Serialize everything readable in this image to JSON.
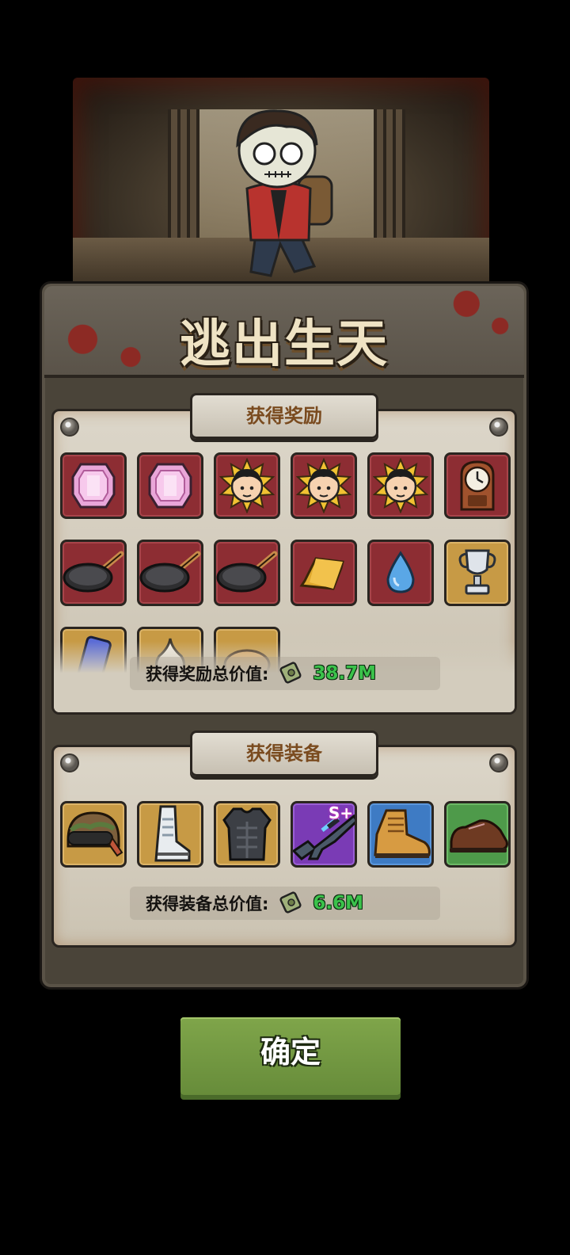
{
  "title": "逃出生天",
  "rewards": {
    "header": "获得奖励",
    "total_label": "获得奖励总价值:",
    "total_value": "38.7M",
    "items": [
      {
        "name": "pink-gem-icon",
        "bg": "red"
      },
      {
        "name": "pink-gem-icon",
        "bg": "red"
      },
      {
        "name": "sun-face-icon",
        "bg": "red"
      },
      {
        "name": "sun-face-icon",
        "bg": "red"
      },
      {
        "name": "sun-face-icon",
        "bg": "red"
      },
      {
        "name": "grandfather-clock-icon",
        "bg": "red"
      },
      {
        "name": "frying-pan-icon",
        "bg": "red"
      },
      {
        "name": "frying-pan-icon",
        "bg": "red"
      },
      {
        "name": "frying-pan-icon",
        "bg": "red"
      },
      {
        "name": "gold-bar-icon",
        "bg": "red"
      },
      {
        "name": "water-drop-icon",
        "bg": "red"
      },
      {
        "name": "silver-trophy-icon",
        "bg": "gold"
      },
      {
        "name": "phone-icon",
        "bg": "gold"
      },
      {
        "name": "garlic-icon",
        "bg": "gold"
      },
      {
        "name": "bread-icon",
        "bg": "gold"
      }
    ]
  },
  "equipment": {
    "header": "获得装备",
    "total_label": "获得装备总价值:",
    "total_value": "6.6M",
    "items": [
      {
        "name": "helmet-icon",
        "bg": "gold"
      },
      {
        "name": "boot-icon",
        "bg": "gold"
      },
      {
        "name": "body-armor-icon",
        "bg": "gold"
      },
      {
        "name": "rifle-icon",
        "bg": "purple",
        "badge": "S+"
      },
      {
        "name": "work-boot-icon",
        "bg": "blue"
      },
      {
        "name": "leather-shoe-icon",
        "bg": "green"
      }
    ]
  },
  "confirm_label": "确定",
  "colors": {
    "cash_value": "#3bc24b",
    "header_text": "#7a4b1f",
    "confirm_bg": "#7fa54a"
  }
}
